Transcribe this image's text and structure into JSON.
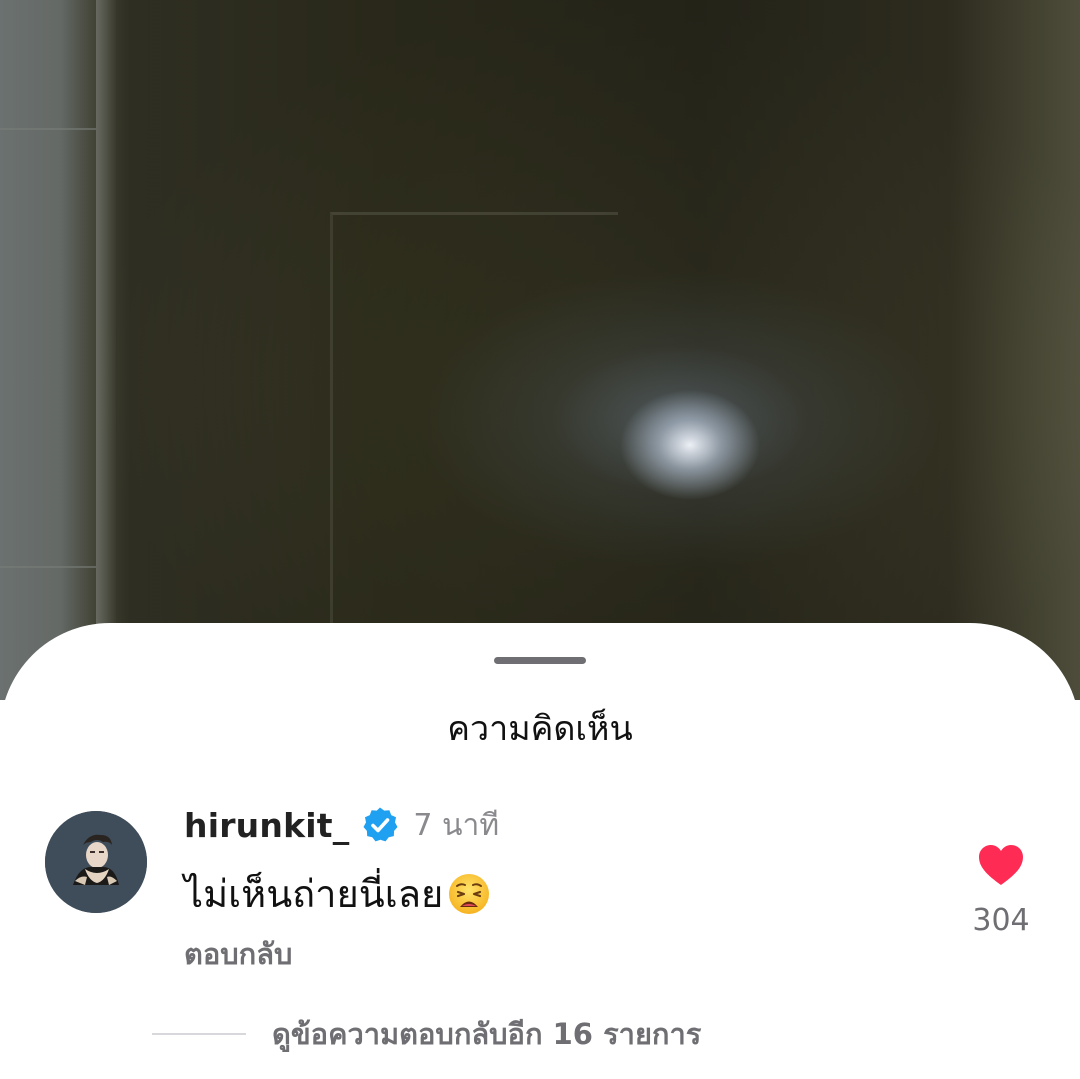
{
  "sheet": {
    "title": "ความคิดเห็น"
  },
  "comment": {
    "username": "hirunkit_",
    "verified": true,
    "timestamp": "7 นาที",
    "text": "ไม่เห็นถ่ายนี่เลย",
    "emoji": "weary-face",
    "reply_label": "ตอบกลับ",
    "like_count": "304",
    "liked": true,
    "view_replies_label": "ดูข้อความตอบกลับอีก 16 รายการ"
  },
  "colors": {
    "like_heart": "#fe2c55",
    "verified_badge": "#20a0f0",
    "avatar_bg": "#3f4c5a"
  }
}
